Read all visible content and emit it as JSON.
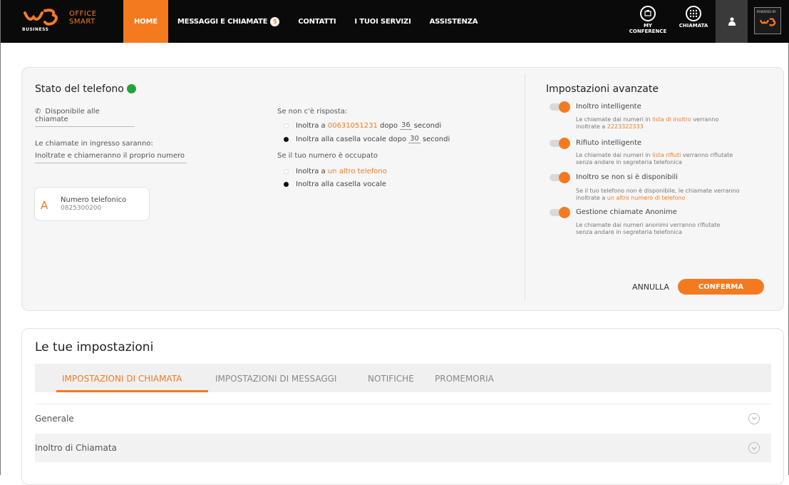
{
  "brand": {
    "logo_text": "BUSINESS",
    "product_line1": "OFFICE",
    "product_line2": "SMART",
    "accent": "#f47a20"
  },
  "nav": {
    "items": [
      {
        "label": "HOME",
        "active": true
      },
      {
        "label": "MESSAGGI E CHIAMATE",
        "badge": "5"
      },
      {
        "label": "CONTATTI"
      },
      {
        "label": "I TUOI SERVIZI"
      },
      {
        "label": "ASSISTENZA"
      }
    ],
    "my_conference": "MY CONFERENCE",
    "chiamata": "CHIAMATA",
    "powered_by": "POWERED BY"
  },
  "phone_status": {
    "title": "Stato del telefono",
    "status_color": "#22a43a",
    "availability": "Disponibile alle chiamate",
    "incoming_label": "Le chiamate in ingresso saranno:",
    "incoming_value": "Inoltrate e chiameranno il proprio numero",
    "number_card": {
      "letter": "A",
      "label": "Numero telefonico",
      "number": "0825300200"
    }
  },
  "no_answer": {
    "heading": "Se non c'è risposta:",
    "opt1_prefix": "Inoltra a",
    "opt1_number": "00631051231",
    "opt1_mid": "dopo",
    "opt1_seconds": "36",
    "opt1_suffix": "secondi",
    "opt2_prefix": "Inoltra alla casella vocale dopo",
    "opt2_seconds": "30",
    "opt2_suffix": "secondi"
  },
  "busy": {
    "heading": "Se il tuo numero è occupato",
    "opt1_prefix": "Inoltra a",
    "opt1_link": "un altro telefono",
    "opt2": "Inoltra alla casella vocale"
  },
  "advanced": {
    "title": "Impostazioni avanzate",
    "items": [
      {
        "title": "Inoltro intelligente",
        "d1": "Le chiamate dai numeri in",
        "link": "lista di inoltro",
        "d2": "verranno",
        "d3": "inoltrate a",
        "link2": "2223322333"
      },
      {
        "title": "Rifiuto intelligente",
        "d1": "Le chiamate dai numeri in",
        "link": "lista rifiuti",
        "d2": "verranno rifiutate",
        "d3": "senza andare in segreteria telefonica"
      },
      {
        "title": "Inoltro se non si è disponibili",
        "d1": "Se il tuo telefono non è disponibile, le chiamate verranno",
        "d3": "inoltrate a",
        "link2": "un altro numero di telefono"
      },
      {
        "title": "Gestione chiamate Anonime",
        "d1": "Le chiamate dai numeri anonimi verranno rifiutate",
        "d3": "senza andare in segreteria telefonica"
      }
    ],
    "cancel": "ANNULLA",
    "confirm": "CONFERMA"
  },
  "settings": {
    "title": "Le tue impostazioni",
    "tabs": [
      "IMPOSTAZIONI DI CHIAMATA",
      "IMPOSTAZIONI DI MESSAGGI",
      "NOTIFICHE",
      "PROMEMORIA"
    ],
    "rows": [
      "Generale",
      "Inoltro di Chiamata"
    ]
  }
}
